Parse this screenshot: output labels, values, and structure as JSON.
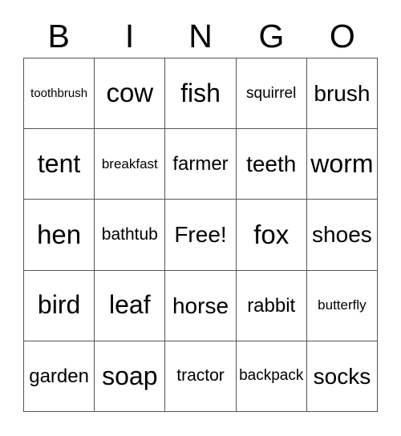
{
  "card": {
    "title": "BINGO",
    "header_letters": [
      "B",
      "I",
      "N",
      "G",
      "O"
    ],
    "free_space_label": "Free!",
    "colors": {
      "background": "#ffffff",
      "text": "#000000",
      "grid_line": "#555555"
    },
    "rows": [
      [
        {
          "text": "toothbrush"
        },
        {
          "text": "cow"
        },
        {
          "text": "fish"
        },
        {
          "text": "squirrel"
        },
        {
          "text": "brush"
        }
      ],
      [
        {
          "text": "tent"
        },
        {
          "text": "breakfast"
        },
        {
          "text": "farmer"
        },
        {
          "text": "teeth"
        },
        {
          "text": "worm"
        }
      ],
      [
        {
          "text": "hen"
        },
        {
          "text": "bathtub"
        },
        {
          "text": "Free!"
        },
        {
          "text": "fox"
        },
        {
          "text": "shoes"
        }
      ],
      [
        {
          "text": "bird"
        },
        {
          "text": "leaf"
        },
        {
          "text": "horse"
        },
        {
          "text": "rabbit"
        },
        {
          "text": "butterfly"
        }
      ],
      [
        {
          "text": "garden"
        },
        {
          "text": "soap"
        },
        {
          "text": "tractor"
        },
        {
          "text": "backpack"
        },
        {
          "text": "socks"
        }
      ]
    ]
  }
}
